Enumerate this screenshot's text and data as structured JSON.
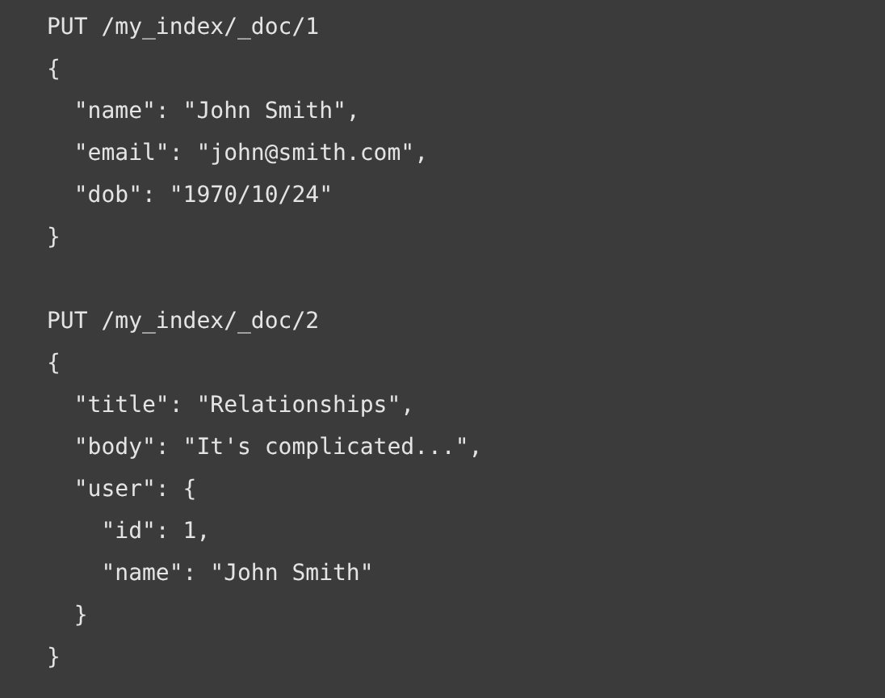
{
  "code_blocks": [
    {
      "lines": [
        "PUT /my_index/_doc/1",
        "{",
        "  \"name\": \"John Smith\",",
        "  \"email\": \"john@smith.com\",",
        "  \"dob\": \"1970/10/24\"",
        "}"
      ]
    },
    {
      "lines": [
        "PUT /my_index/_doc/2",
        "{",
        "  \"title\": \"Relationships\",",
        "  \"body\": \"It's complicated...\",",
        "  \"user\": {",
        "    \"id\": 1,",
        "    \"name\": \"John Smith\"",
        "  }",
        "}"
      ]
    }
  ]
}
